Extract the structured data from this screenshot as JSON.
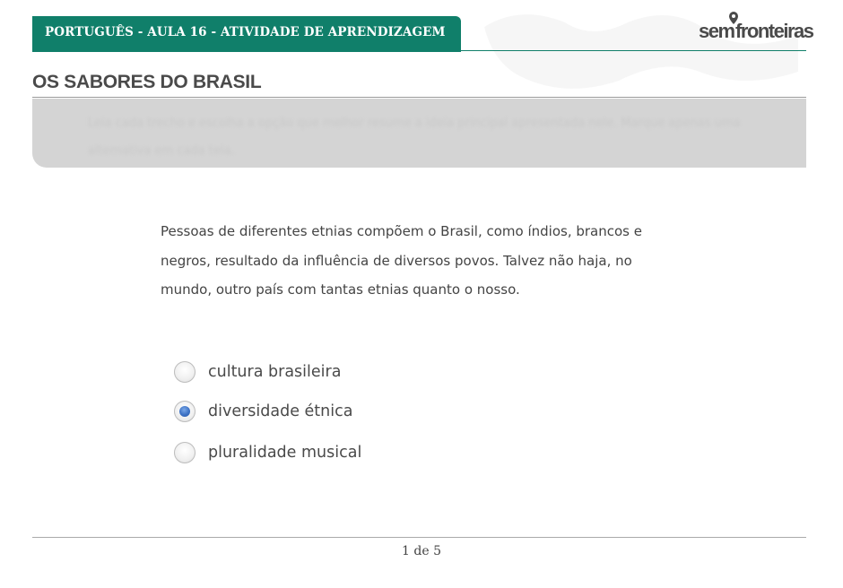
{
  "header": {
    "banner_text": "PORTUGUÊS - AULA 16 - ATIVIDADE DE APRENDIZAGEM",
    "accent_color": "#107f6a"
  },
  "logo": {
    "part1": "sem",
    "part2": "fronteiras",
    "icon": "location-pin-icon"
  },
  "page": {
    "title": "OS SABORES DO BRASIL"
  },
  "instructions": {
    "text": "Leia cada trecho e escolha a opção que melhor resume a ideia principal apresentada nele. Marque apenas uma alternativa em cada tela."
  },
  "question": {
    "passage": "Pessoas de diferentes etnias compõem o Brasil, como índios, brancos e negros, resultado da influência de diversos povos. Talvez não haja, no mundo, outro país com tantas etnias quanto o nosso.",
    "options": [
      {
        "label": "cultura brasileira",
        "selected": false
      },
      {
        "label": "diversidade étnica",
        "selected": true
      },
      {
        "label": "pluralidade musical",
        "selected": false
      }
    ]
  },
  "footer": {
    "pager": "1 de 5"
  }
}
